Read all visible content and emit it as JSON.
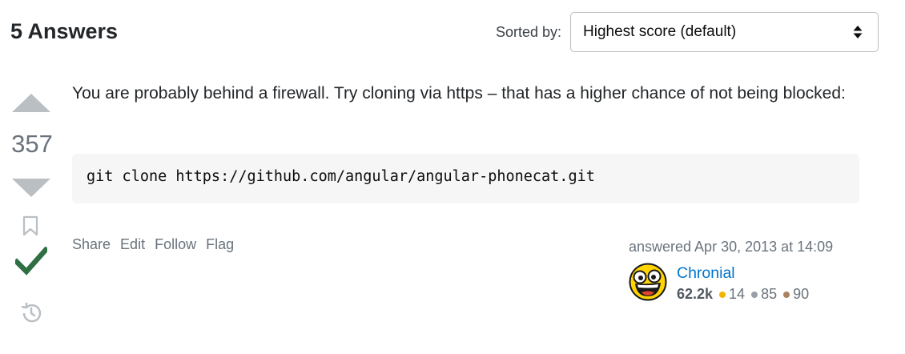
{
  "header": {
    "answers_count": "5 Answers",
    "sort_label": "Sorted by:",
    "sort_value": "Highest score (default)"
  },
  "answer": {
    "score": "357",
    "accepted": true,
    "body_text": "You are probably behind a firewall. Try cloning via https – that has a higher chance of not being blocked:",
    "code": "git clone https://github.com/angular/angular-phonecat.git",
    "menu": {
      "share": "Share",
      "edit": "Edit",
      "follow": "Follow",
      "flag": "Flag"
    },
    "user": {
      "action": "answered Apr 30, 2013 at 14:09",
      "name": "Chronial",
      "reputation": "62.2k",
      "gold": "14",
      "silver": "85",
      "bronze": "90"
    }
  },
  "colors": {
    "accepted_check": "#2f6f44",
    "gold": "#f1b600",
    "silver": "#9a9ea5",
    "bronze": "#ab825f",
    "link": "#0074cc"
  },
  "icons": {
    "sort": "sort-arrows-icon",
    "upvote": "upvote-arrow-icon",
    "downvote": "downvote-arrow-icon",
    "bookmark": "bookmark-icon",
    "accepted": "checkmark-icon",
    "history": "history-icon"
  }
}
